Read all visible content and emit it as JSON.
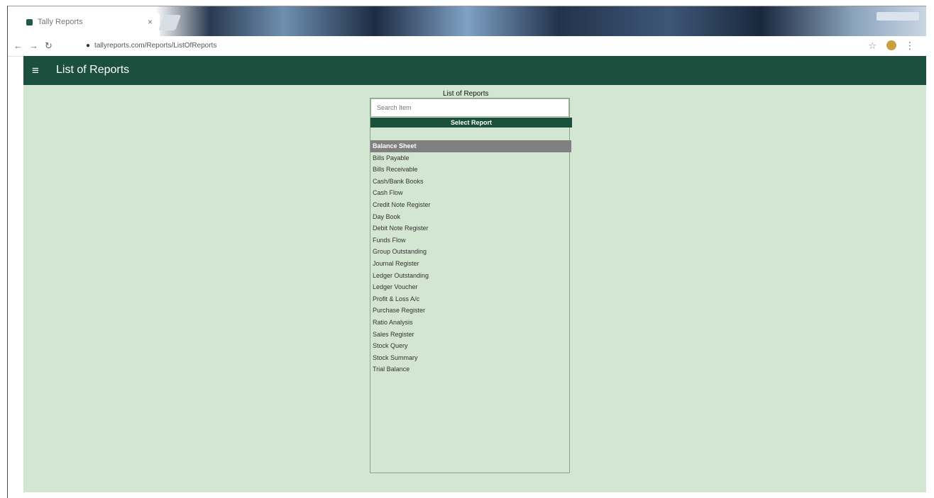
{
  "browser": {
    "tab_title": "Tally Reports",
    "tab_close": "×",
    "address": "tallyreports.com/Reports/ListOfReports",
    "nav": {
      "back": "←",
      "forward": "→",
      "reload": "↻"
    },
    "menu": "⋮",
    "star": "☆"
  },
  "header": {
    "menu_icon": "≡",
    "title": "List of Reports"
  },
  "panel": {
    "title": "List of Reports",
    "search_placeholder": "Search Item",
    "select_label": "Select Report",
    "reports": [
      "Balance Sheet",
      "Bills Payable",
      "Bills Receivable",
      "Cash/Bank Books",
      "Cash Flow",
      "Credit Note Register",
      "Day Book",
      "Debit Note Register",
      "Funds Flow",
      "Group Outstanding",
      "Journal Register",
      "Ledger Outstanding",
      "Ledger Voucher",
      "Profit & Loss A/c",
      "Purchase Register",
      "Ratio Analysis",
      "Sales Register",
      "Stock Query",
      "Stock Summary",
      "Trial Balance"
    ],
    "selected_index": 0
  },
  "colors": {
    "header": "#1b4f3e",
    "content_bg": "#d3e6d1",
    "selected": "#808080"
  }
}
